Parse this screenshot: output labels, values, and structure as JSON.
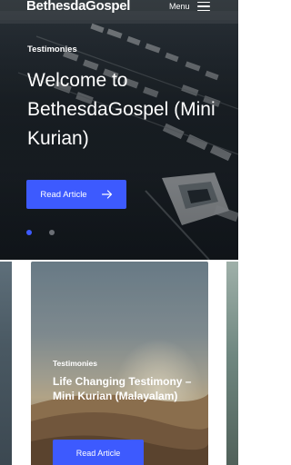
{
  "header": {
    "logo_text": "BethesdaGospel",
    "menu_label": "Menu"
  },
  "hero": {
    "category": "Testimonies",
    "title": "Welcome to BethesdaGospel (Mini Kurian)",
    "button_label": "Read Article",
    "slide_count": 2,
    "active_slide": 1
  },
  "carousel": {
    "cards": [
      {
        "category": "Testimonies",
        "title": "Life Changing Testimony – Mini Kurian (Malayalam)",
        "button_label": "Read Article"
      }
    ]
  },
  "colors": {
    "accent": "#3d5afe",
    "text_on_dark": "#ffffff",
    "dot_inactive": "#6b6f75"
  },
  "icons": {
    "menu": "hamburger-icon",
    "button_arrow": "arrow-right-icon"
  }
}
